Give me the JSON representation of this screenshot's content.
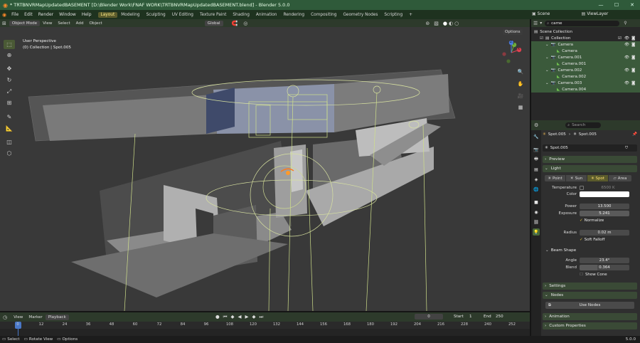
{
  "window": {
    "title": "* TRTBNVRMapUpdatedBASEMENT [D:\\Blender Work\\FNAF WORK\\TRTBNVRMapUpdatedBASEMENT.blend] - Blender 5.0.0",
    "minimize": "—",
    "maximize": "☐",
    "close": "✕"
  },
  "menu": [
    "File",
    "Edit",
    "Render",
    "Window",
    "Help"
  ],
  "workspaces": [
    "Layout",
    "Modeling",
    "Sculpting",
    "UV Editing",
    "Texture Paint",
    "Shading",
    "Animation",
    "Rendering",
    "Compositing",
    "Geometry Nodes",
    "Scripting"
  ],
  "active_workspace": "Layout",
  "add_workspace": "+",
  "scene": "Scene",
  "view_layer": "ViewLayer",
  "viewport_header": {
    "mode": "Object Mode",
    "menus": [
      "View",
      "Select",
      "Add",
      "Object"
    ],
    "orientation": "Global",
    "options": "Options"
  },
  "viewport": {
    "view_name": "User Perspective",
    "collection_info": "(0) Collection | Spot.005"
  },
  "gizmo": {
    "x": "X",
    "y": "Y",
    "z": "Z"
  },
  "timeline": {
    "menus": [
      "View",
      "Marker",
      "Playback"
    ],
    "current_frame": "0",
    "start_label": "Start",
    "start": "1",
    "end_label": "End",
    "end": "250",
    "ticks": [
      "0",
      "12",
      "24",
      "36",
      "48",
      "60",
      "72",
      "84",
      "96",
      "108",
      "120",
      "132",
      "144",
      "156",
      "168",
      "180",
      "192",
      "204",
      "216",
      "228",
      "240",
      "252"
    ]
  },
  "status": {
    "select": "Select",
    "rotate": "Rotate View",
    "options": "Options",
    "version": "5.0.0"
  },
  "outliner": {
    "search": "came",
    "rows": [
      {
        "label": "Scene Collection",
        "depth": 0,
        "icon": "collection-icon"
      },
      {
        "label": "Collection",
        "depth": 1,
        "icon": "collection-icon"
      },
      {
        "label": "Camera",
        "depth": 2,
        "icon": "camera-object-icon"
      },
      {
        "label": "Camera",
        "depth": 3,
        "icon": "camera-data-icon"
      },
      {
        "label": "Camera.001",
        "depth": 2,
        "icon": "camera-object-icon"
      },
      {
        "label": "Camera.001",
        "depth": 3,
        "icon": "camera-data-icon"
      },
      {
        "label": "Camera.002",
        "depth": 2,
        "icon": "camera-object-icon"
      },
      {
        "label": "Camera.002",
        "depth": 3,
        "icon": "camera-data-icon"
      },
      {
        "label": "Camera.003",
        "depth": 2,
        "icon": "camera-object-icon"
      },
      {
        "label": "Camera.004",
        "depth": 3,
        "icon": "camera-data-icon"
      }
    ]
  },
  "properties": {
    "search_placeholder": "Search",
    "object": "Spot.005",
    "data": "Spot.005",
    "datablock": "Spot.005",
    "panels": {
      "preview": "Preview",
      "light": "Light",
      "settings": "Settings",
      "nodes": "Nodes",
      "animation": "Animation",
      "custom": "Custom Properties"
    },
    "light_types": [
      "Point",
      "Sun",
      "Spot",
      "Area"
    ],
    "active_type": "Spot",
    "temperature_label": "Temperature",
    "temperature": "6500 K",
    "color_label": "Color",
    "light_color": "#ffffff",
    "power_label": "Power",
    "power": "13.500",
    "exposure_label": "Exposure",
    "exposure": "5.241",
    "normalize": "Normalize",
    "radius_label": "Radius",
    "radius": "0.02 m",
    "soft_falloff": "Soft Falloff",
    "beam_shape": "Beam Shape",
    "angle_label": "Angle",
    "angle": "23.4°",
    "blend_label": "Blend",
    "blend": "0.364",
    "show_cone": "Show Cone",
    "use_nodes": "Use Nodes"
  },
  "colors": {
    "title_green": "#2f5a3a",
    "accent_yellow": "#ffee88",
    "selected_row": "#3b5a3b"
  }
}
